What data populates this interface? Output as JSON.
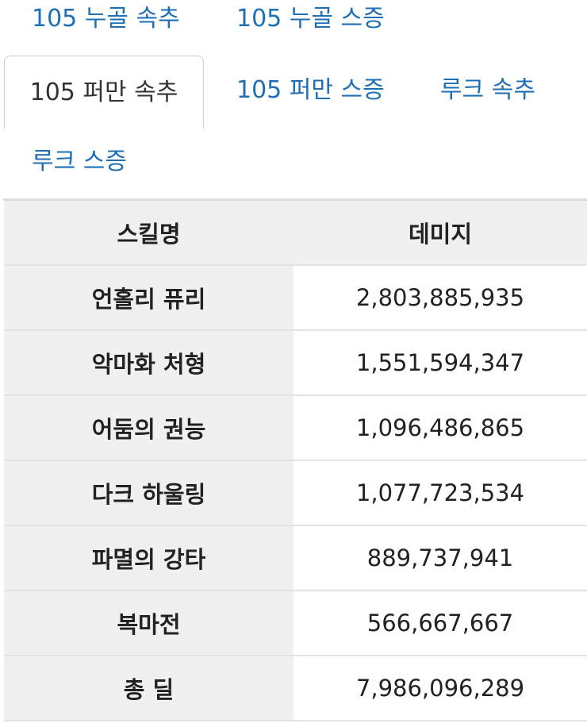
{
  "tabs": [
    {
      "label": "105 누골 속추"
    },
    {
      "label": "105 누골 스증"
    },
    {
      "label": "105 퍼만 속추"
    },
    {
      "label": "105 퍼만 스증"
    },
    {
      "label": "루크 속추"
    },
    {
      "label": "루크 스증"
    }
  ],
  "active_tab": "105 퍼만 속추",
  "table": {
    "headers": [
      "스킬명",
      "데미지"
    ],
    "rows": [
      {
        "skill": "언홀리 퓨리",
        "damage": "2,803,885,935"
      },
      {
        "skill": "악마화 처형",
        "damage": "1,551,594,347"
      },
      {
        "skill": "어둠의 권능",
        "damage": "1,096,486,865"
      },
      {
        "skill": "다크 하울링",
        "damage": "1,077,723,534"
      },
      {
        "skill": "파멸의 강타",
        "damage": "889,737,941"
      },
      {
        "skill": "복마전",
        "damage": "566,667,667"
      },
      {
        "skill": "총 딜",
        "damage": "7,986,096,289"
      }
    ]
  },
  "colors": {
    "link": "#1f6fb5",
    "header_bg": "#f0f0f0",
    "border": "#e4e4e4"
  }
}
